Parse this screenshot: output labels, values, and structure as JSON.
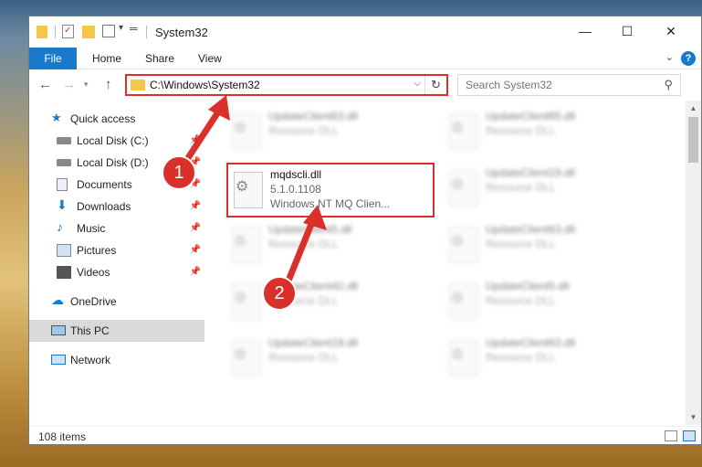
{
  "window": {
    "title": "System32",
    "controls": {
      "minimize": "—",
      "maximize": "☐",
      "close": "✕"
    }
  },
  "ribbon": {
    "file": "File",
    "tabs": [
      "Home",
      "Share",
      "View"
    ],
    "help": "?"
  },
  "nav": {
    "address": "C:\\Windows\\System32",
    "search_placeholder": "Search System32"
  },
  "sidebar": {
    "items": [
      {
        "label": "Quick access",
        "icon": "star-icon"
      },
      {
        "label": "Local Disk (C:)",
        "icon": "drive-icon"
      },
      {
        "label": "Local Disk (D:)",
        "icon": "drive-icon"
      },
      {
        "label": "Documents",
        "icon": "documents-icon"
      },
      {
        "label": "Downloads",
        "icon": "download-icon"
      },
      {
        "label": "Music",
        "icon": "music-icon"
      },
      {
        "label": "Pictures",
        "icon": "pictures-icon"
      },
      {
        "label": "Videos",
        "icon": "videos-icon"
      },
      {
        "label": "OneDrive",
        "icon": "cloud-icon"
      },
      {
        "label": "This PC",
        "icon": "computer-icon"
      },
      {
        "label": "Network",
        "icon": "network-icon"
      }
    ]
  },
  "files": {
    "left": [
      {
        "name": "UpdateClient63.dll",
        "type": "Resource DLL"
      },
      {
        "name": "mqdscli.dll",
        "version": "5.1.0.1108",
        "desc": "Windows NT MQ Clien..."
      },
      {
        "name": "UpdateClient5.dll",
        "type": "Resource DLL"
      },
      {
        "name": "UpdateClient42.dll",
        "type": "Resource DLL"
      },
      {
        "name": "UpdateClient19.dll",
        "type": "Resource DLL"
      }
    ],
    "right": [
      {
        "name": "UpdateClient65.dll",
        "type": "Resource DLL"
      },
      {
        "name": "UpdateClient19.dll",
        "type": "Resource DLL"
      },
      {
        "name": "UpdateClient63.dll",
        "type": "Resource DLL"
      },
      {
        "name": "UpdateClient5.dll",
        "type": "Resource DLL"
      },
      {
        "name": "UpdateClient63.dll",
        "type": "Resource DLL"
      }
    ]
  },
  "status": {
    "items": "108 items"
  },
  "annotations": {
    "step1": "1",
    "step2": "2"
  },
  "colors": {
    "accent": "#1979ca",
    "highlight": "#d9302b",
    "folder": "#f5c748"
  }
}
